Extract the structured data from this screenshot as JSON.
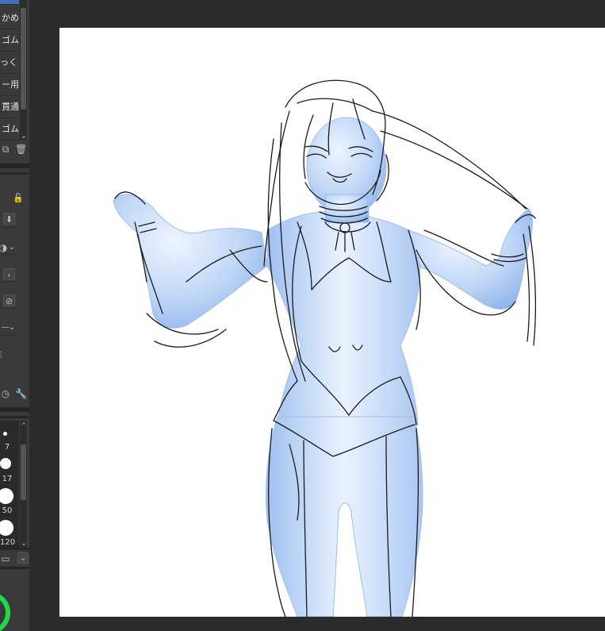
{
  "subtool_panel": {
    "items": [
      {
        "label": "かめ"
      },
      {
        "label": "ゴム"
      },
      {
        "label": "っくり"
      },
      {
        "label": "ー用"
      },
      {
        "label": "貫通"
      },
      {
        "label": "ゴム"
      }
    ],
    "selected_index": -1
  },
  "brush_sizes": {
    "items": [
      {
        "size": "7"
      },
      {
        "size": "17"
      },
      {
        "size": "50"
      },
      {
        "size": "120"
      }
    ]
  },
  "colors": {
    "panel_bg": "#3a3a3a",
    "canvas_bg": "#ffffff",
    "workspace_bg": "#2b2b2b",
    "selected_tab": "#3d6fb6",
    "color_ring": "#21d84a",
    "figure_fill": "#a9c8f3",
    "sketch_line": "#1a1a1a"
  }
}
